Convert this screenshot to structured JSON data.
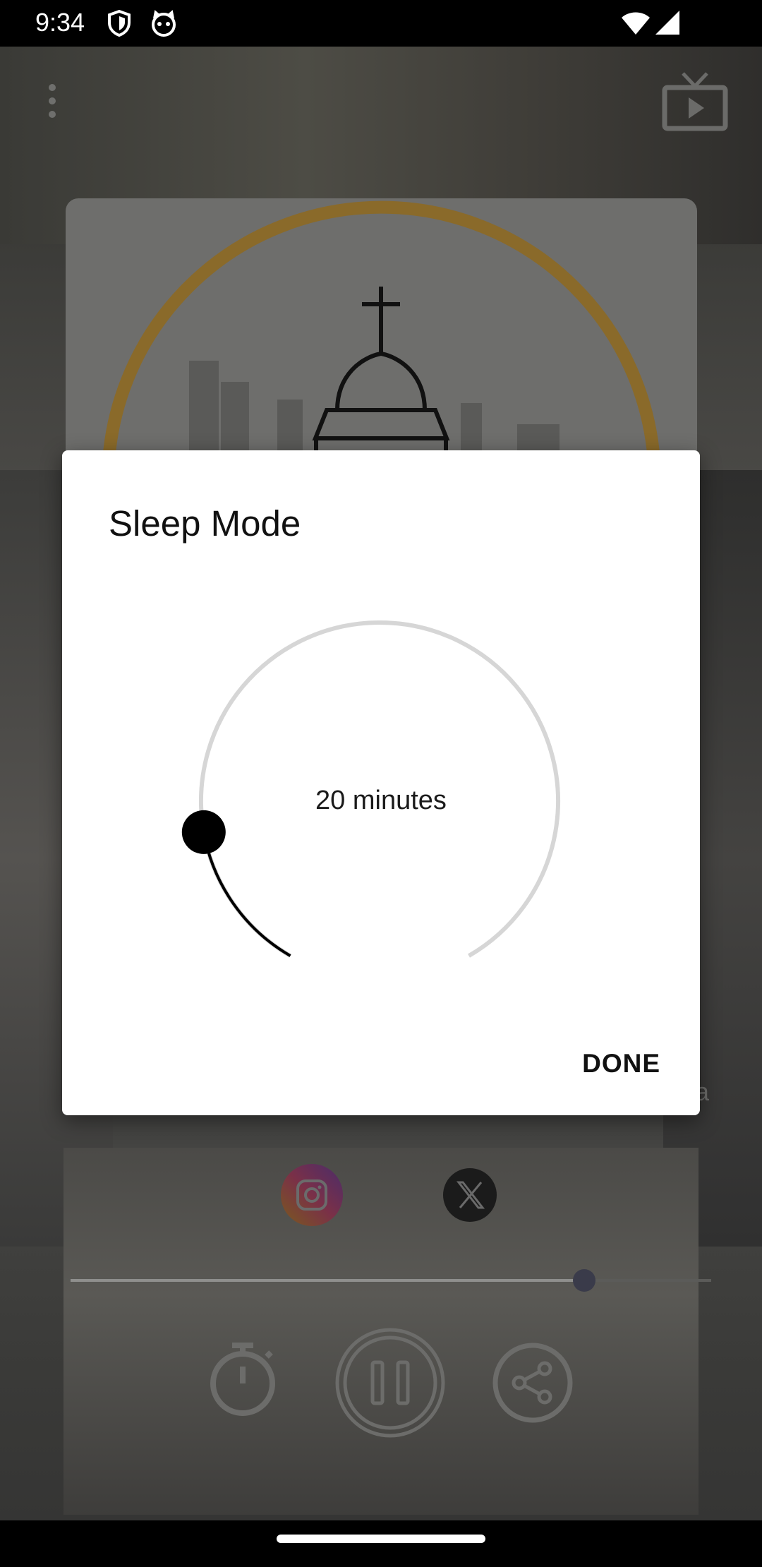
{
  "status_bar": {
    "time": "9:34",
    "left_icons": [
      "shield-icon",
      "cat-face-icon"
    ],
    "right_icons": [
      "wifi-icon",
      "cellular-signal-icon"
    ]
  },
  "background_app": {
    "overflow_menu_icon": "vertical-dots-icon",
    "cast_icon": "tv-play-icon",
    "social_icons": [
      "instagram-icon",
      "x-icon"
    ],
    "partial_text": "a",
    "progress_fraction": 0.8,
    "controls": [
      "timer-icon",
      "pause-icon",
      "share-icon"
    ]
  },
  "dialog": {
    "title": "Sleep Mode",
    "dial_value_text": "20 minutes",
    "dial_value_minutes": 20,
    "done_label": "DONE"
  },
  "colors": {
    "dialog_bg": "#ffffff",
    "track": "#d6d6d6",
    "progress": "#000000",
    "gold_ring": "#b8892e"
  }
}
